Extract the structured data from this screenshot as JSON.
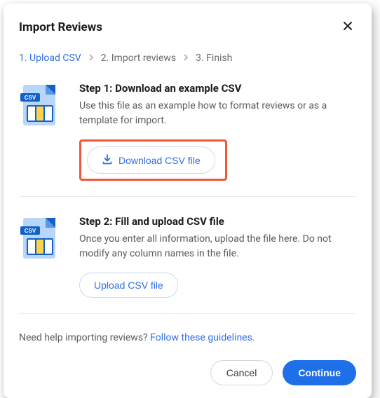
{
  "title": "Import Reviews",
  "stepper": [
    {
      "num": "1.",
      "label": "Upload CSV",
      "active": true
    },
    {
      "num": "2.",
      "label": "Import reviews",
      "active": false
    },
    {
      "num": "3.",
      "label": "Finish",
      "active": false
    }
  ],
  "step1": {
    "title": "Step 1: Download an example CSV",
    "desc": "Use this file as an example how to format reviews or as a template for import.",
    "button": "Download CSV file"
  },
  "step2": {
    "title": "Step 2: Fill and upload CSV file",
    "desc": "Once you enter all information, upload the file here. Do not modify any column names in the file.",
    "button": "Upload CSV file"
  },
  "help": {
    "text": "Need help importing reviews? ",
    "link": "Follow these guidelines."
  },
  "footer": {
    "cancel": "Cancel",
    "continue": "Continue"
  },
  "colors": {
    "accent": "#2f6fe8",
    "highlight": "#f0563a"
  }
}
